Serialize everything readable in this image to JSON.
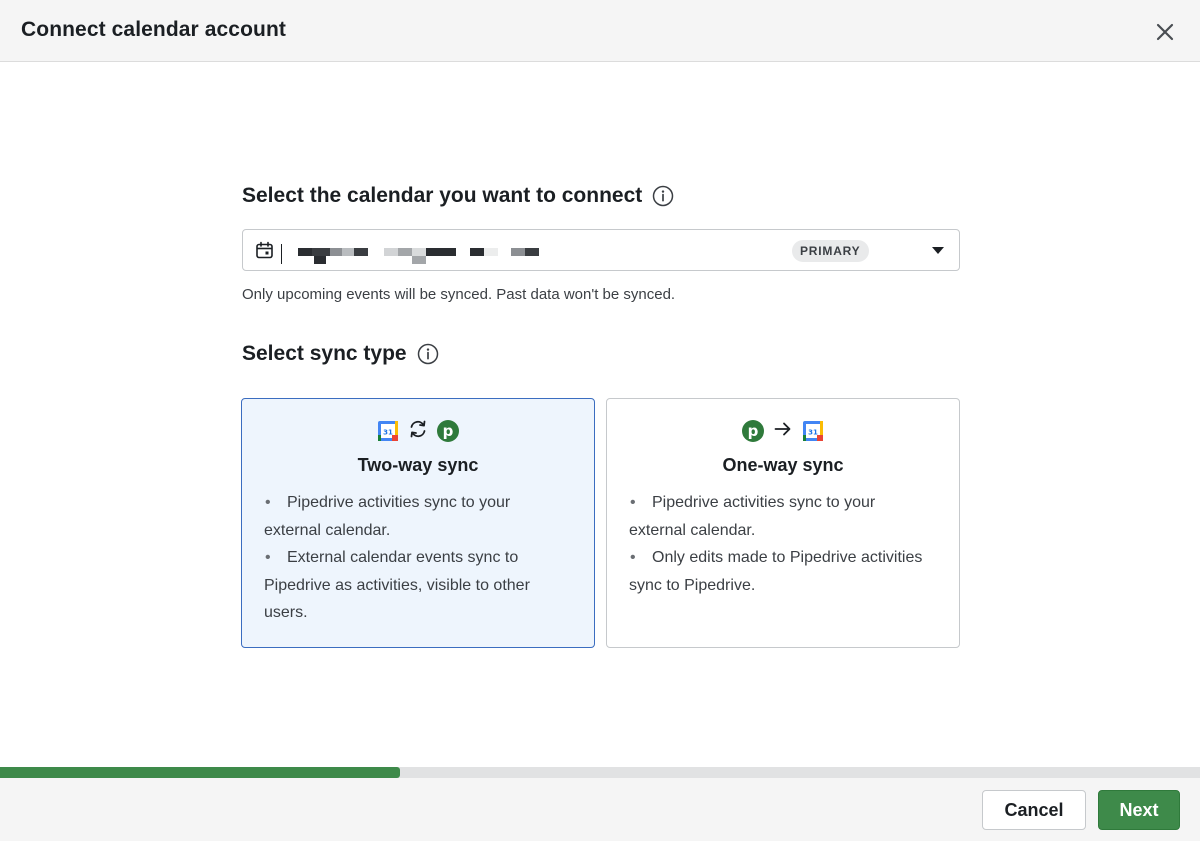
{
  "dialog": {
    "title": "Connect calendar account",
    "close_icon": "close-icon"
  },
  "calendar_section": {
    "title": "Select the calendar you want to connect",
    "info_icon": "info-icon",
    "select": {
      "icon": "calendar-icon",
      "value": "[redacted email]",
      "badge": "PRIMARY",
      "caret_icon": "caret-down-icon"
    },
    "helper": "Only upcoming events will be synced. Past data won't be synced."
  },
  "sync_section": {
    "title": "Select sync type",
    "info_icon": "info-icon",
    "options": [
      {
        "title": "Two-way sync",
        "selected": true,
        "icons": [
          "google-calendar-icon",
          "sync-arrows-icon",
          "pipedrive-icon"
        ],
        "bullets": [
          "Pipedrive activities sync to your external calendar.",
          "External calendar events sync to Pipedrive as activities, visible to other users."
        ]
      },
      {
        "title": "One-way sync",
        "selected": false,
        "icons": [
          "pipedrive-icon",
          "arrow-right-icon",
          "google-calendar-icon"
        ],
        "bullets": [
          "Pipedrive activities sync to your external calendar.",
          "Only edits made to Pipedrive activities sync to Pipedrive."
        ]
      }
    ]
  },
  "progress": {
    "fraction": 0.333
  },
  "footer": {
    "cancel_label": "Cancel",
    "next_label": "Next"
  },
  "colors": {
    "accent_green": "#3e8a4a",
    "selected_border": "#3b6dc0",
    "selected_bg": "#eef5fd"
  }
}
